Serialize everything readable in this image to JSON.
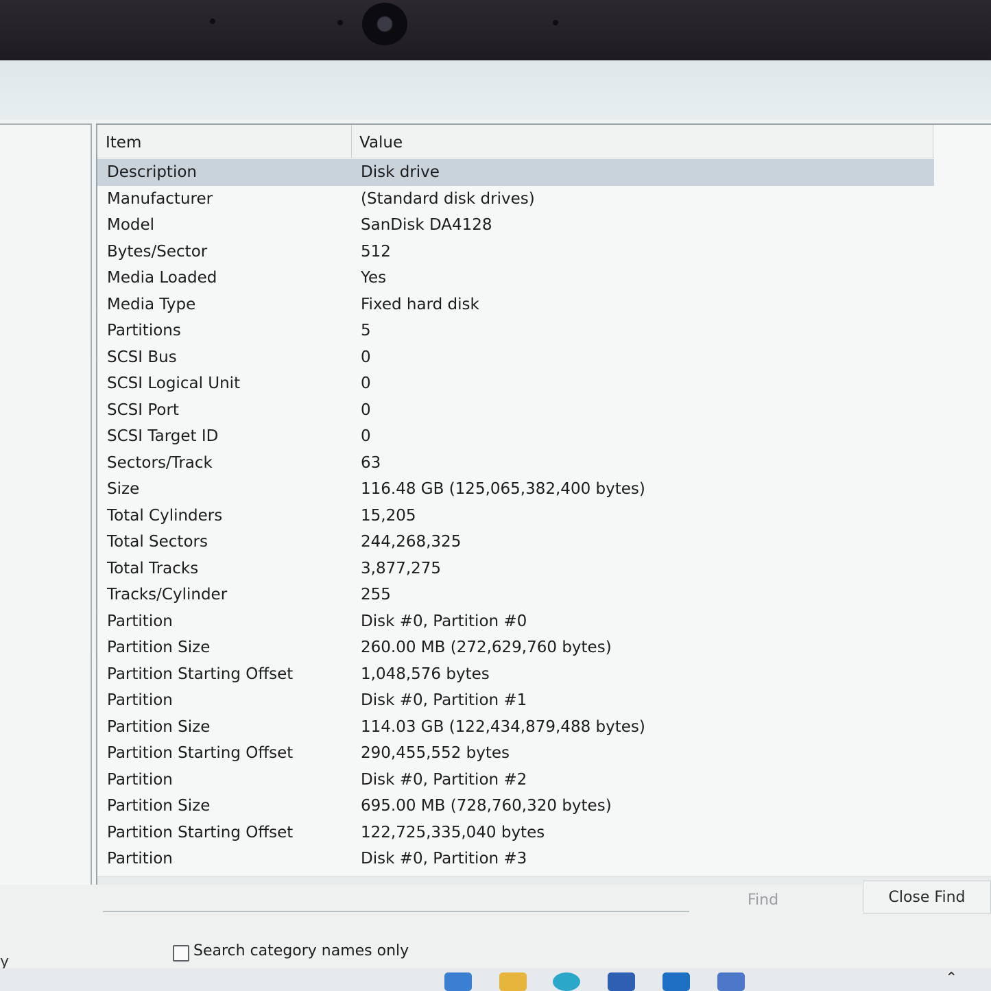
{
  "list": {
    "headers": {
      "item": "Item",
      "value": "Value"
    },
    "rows": [
      {
        "item": "Description",
        "value": "Disk drive"
      },
      {
        "item": "Manufacturer",
        "value": "(Standard disk drives)"
      },
      {
        "item": "Model",
        "value": "SanDisk DA4128"
      },
      {
        "item": "Bytes/Sector",
        "value": "512"
      },
      {
        "item": "Media Loaded",
        "value": "Yes"
      },
      {
        "item": "Media Type",
        "value": "Fixed hard disk"
      },
      {
        "item": "Partitions",
        "value": "5"
      },
      {
        "item": "SCSI Bus",
        "value": "0"
      },
      {
        "item": "SCSI Logical Unit",
        "value": "0"
      },
      {
        "item": "SCSI Port",
        "value": "0"
      },
      {
        "item": "SCSI Target ID",
        "value": "0"
      },
      {
        "item": "Sectors/Track",
        "value": "63"
      },
      {
        "item": "Size",
        "value": "116.48 GB (125,065,382,400 bytes)"
      },
      {
        "item": "Total Cylinders",
        "value": "15,205"
      },
      {
        "item": "Total Sectors",
        "value": "244,268,325"
      },
      {
        "item": "Total Tracks",
        "value": "3,877,275"
      },
      {
        "item": "Tracks/Cylinder",
        "value": "255"
      },
      {
        "item": "Partition",
        "value": "Disk #0, Partition #0"
      },
      {
        "item": "Partition Size",
        "value": "260.00 MB (272,629,760 bytes)"
      },
      {
        "item": "Partition Starting Offset",
        "value": "1,048,576 bytes"
      },
      {
        "item": "Partition",
        "value": "Disk #0, Partition #1"
      },
      {
        "item": "Partition Size",
        "value": "114.03 GB (122,434,879,488 bytes)"
      },
      {
        "item": "Partition Starting Offset",
        "value": "290,455,552 bytes"
      },
      {
        "item": "Partition",
        "value": "Disk #0, Partition #2"
      },
      {
        "item": "Partition Size",
        "value": "695.00 MB (728,760,320 bytes)"
      },
      {
        "item": "Partition Starting Offset",
        "value": "122,725,335,040 bytes"
      },
      {
        "item": "Partition",
        "value": "Disk #0, Partition #3"
      }
    ]
  },
  "find_bar": {
    "find_label": "Find",
    "close_find_label": "Close Find",
    "search_category_label": "Search category names only",
    "left_label_fragment": "y"
  },
  "colors": {
    "selection": "#c9d3dc",
    "window_bg": "#f6f8f7"
  }
}
